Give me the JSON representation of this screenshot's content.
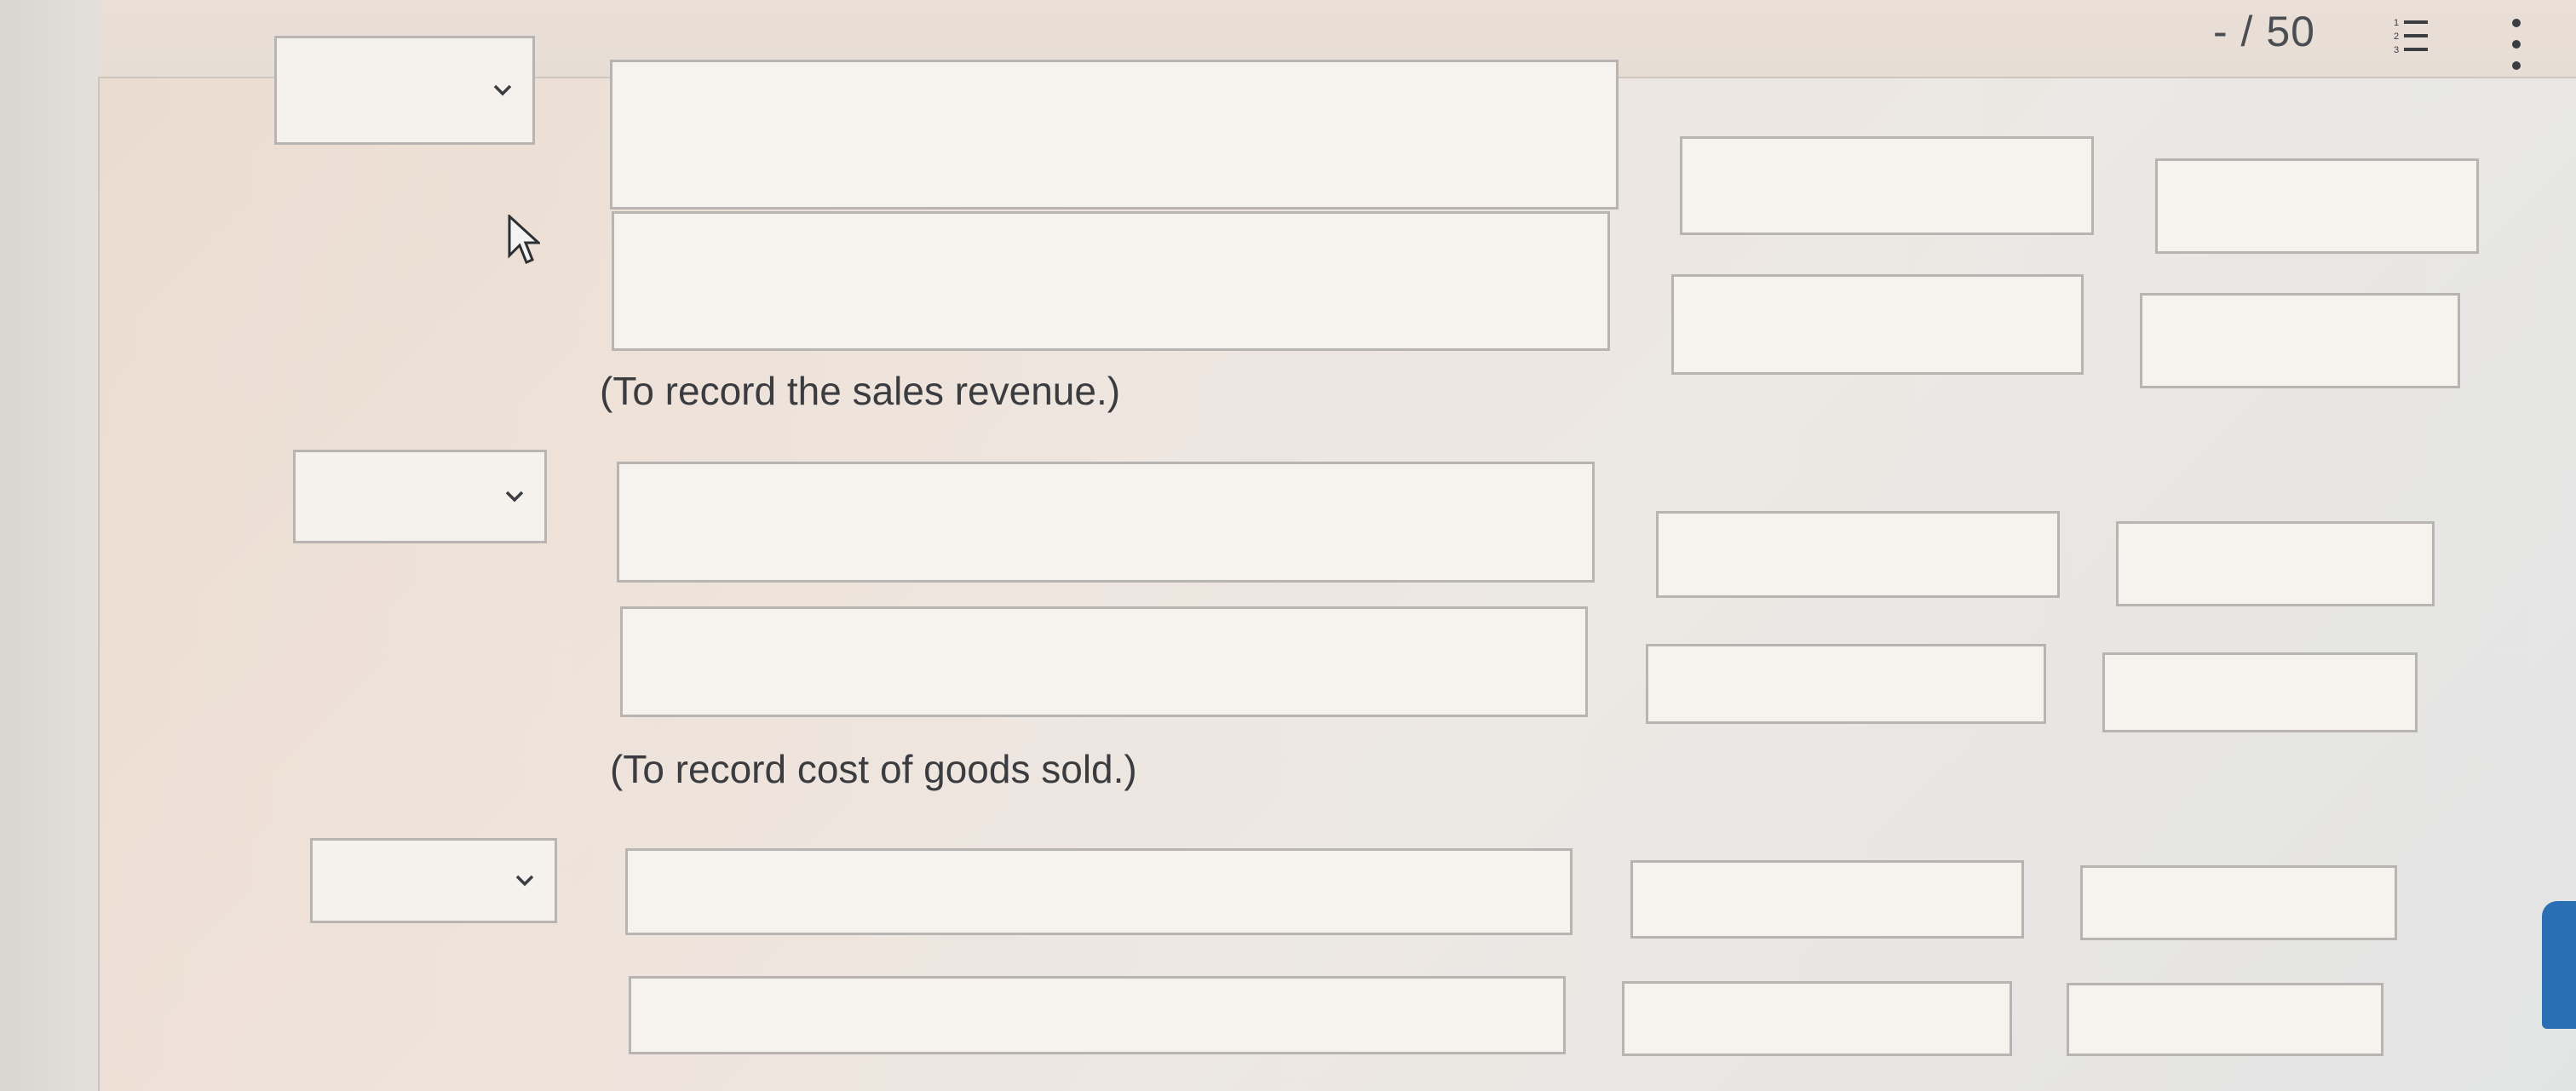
{
  "header": {
    "score": "- / 50"
  },
  "icons": {
    "list": "list-icon",
    "more": "more-vertical-icon",
    "cursor": "mouse-pointer-icon"
  },
  "entries": [
    {
      "account_value": "",
      "rows": [
        {
          "account": "",
          "debit": "",
          "credit": ""
        },
        {
          "account": "",
          "debit": "",
          "credit": ""
        }
      ],
      "note": "(To record the sales revenue.)"
    },
    {
      "account_value": "",
      "rows": [
        {
          "account": "",
          "debit": "",
          "credit": ""
        },
        {
          "account": "",
          "debit": "",
          "credit": ""
        }
      ],
      "note": "(To record cost of goods sold.)"
    },
    {
      "account_value": "",
      "rows": [
        {
          "account": "",
          "debit": "",
          "credit": ""
        },
        {
          "account": "",
          "debit": "",
          "credit": ""
        }
      ]
    }
  ],
  "colors": {
    "accent": "#2a6fb4",
    "text": "#3b3c3f",
    "border": "#b7b4b1"
  }
}
